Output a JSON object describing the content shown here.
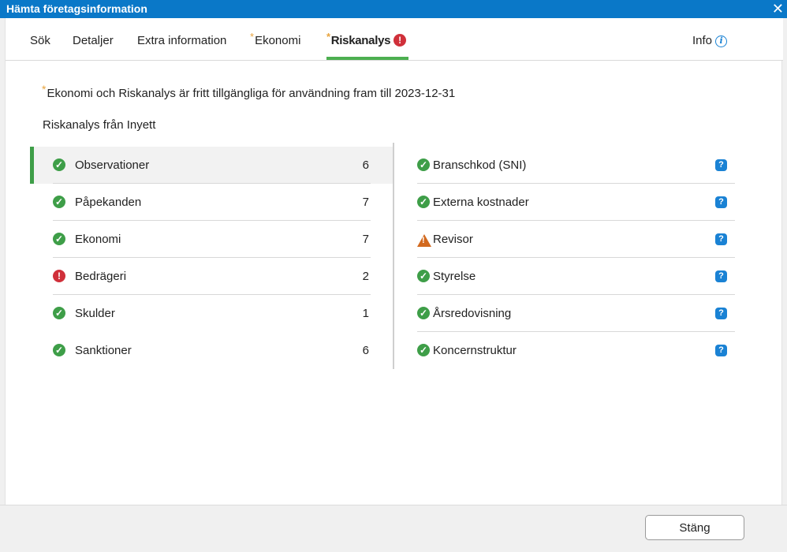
{
  "window": {
    "title": "Hämta företagsinformation",
    "close_glyph": "✕"
  },
  "tabs": [
    {
      "label": "Sök"
    },
    {
      "label": "Detaljer"
    },
    {
      "label": "Extra information"
    },
    {
      "label": "Ekonomi",
      "star": "*"
    },
    {
      "label": "Riskanalys",
      "star": "*",
      "badge": "!",
      "active": true
    },
    {
      "label": "Info",
      "icon": "info-icon",
      "icon_glyph": "i"
    }
  ],
  "notice": {
    "star": "*",
    "text": "Ekonomi och Riskanalys är fritt tillgängliga för användning fram till 2023-12-31"
  },
  "subtitle": "Riskanalys från Inyett",
  "left_items": [
    {
      "label": "Observationer",
      "count": "6",
      "status": "ok",
      "glyph": "✓",
      "selected": true
    },
    {
      "label": "Påpekanden",
      "count": "7",
      "status": "ok",
      "glyph": "✓"
    },
    {
      "label": "Ekonomi",
      "count": "7",
      "status": "ok",
      "glyph": "✓"
    },
    {
      "label": "Bedrägeri",
      "count": "2",
      "status": "error",
      "glyph": "!"
    },
    {
      "label": "Skulder",
      "count": "1",
      "status": "ok",
      "glyph": "✓"
    },
    {
      "label": "Sanktioner",
      "count": "6",
      "status": "ok",
      "glyph": "✓"
    }
  ],
  "right_items": [
    {
      "label": "Branschkod (SNI)",
      "status": "ok",
      "glyph": "✓",
      "help": "?"
    },
    {
      "label": "Externa kostnader",
      "status": "ok",
      "glyph": "✓",
      "help": "?"
    },
    {
      "label": "Revisor",
      "status": "warning",
      "help": "?"
    },
    {
      "label": "Styrelse",
      "status": "ok",
      "glyph": "✓",
      "help": "?"
    },
    {
      "label": "Årsredovisning",
      "status": "ok",
      "glyph": "✓",
      "help": "?"
    },
    {
      "label": "Koncernstruktur",
      "status": "ok",
      "glyph": "✓",
      "help": "?"
    }
  ],
  "footer": {
    "close_label": "Stäng"
  },
  "colors": {
    "titlebar": "#0a78c8",
    "ok": "#3e9e48",
    "error": "#d0303a",
    "warning": "#d2691e",
    "help": "#1a82d4",
    "star": "#e8a33d"
  }
}
